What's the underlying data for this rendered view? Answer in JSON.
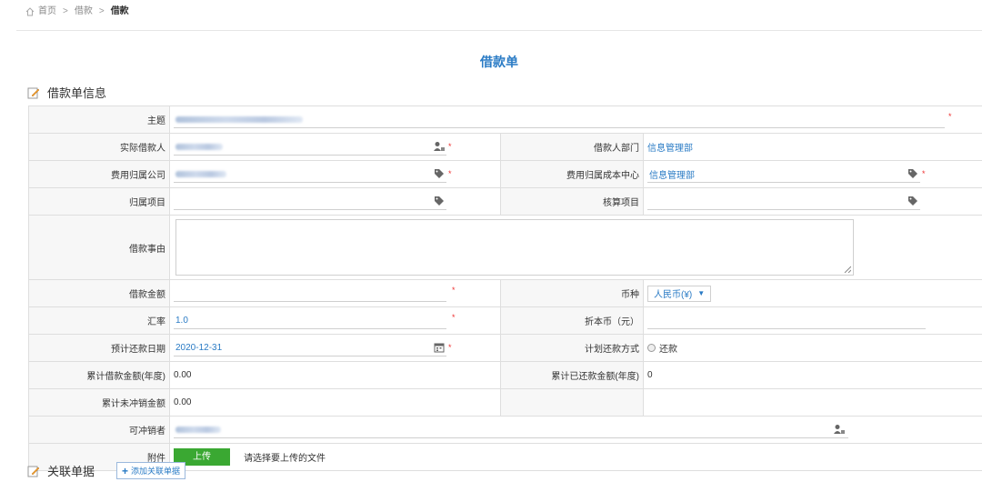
{
  "breadcrumb": {
    "home": "首页",
    "level1": "借款",
    "current": "借款"
  },
  "form": {
    "title": "借款单"
  },
  "section1": {
    "title": "借款单信息"
  },
  "fields": {
    "subject": {
      "label": "主题"
    },
    "borrower": {
      "label": "实际借款人"
    },
    "borrower_dept": {
      "label": "借款人部门",
      "value": "信息管理部"
    },
    "company": {
      "label": "费用归属公司"
    },
    "cost_center": {
      "label": "费用归属成本中心",
      "value": "信息管理部"
    },
    "project": {
      "label": "归属项目"
    },
    "account_item": {
      "label": "核算项目"
    },
    "reason": {
      "label": "借款事由"
    },
    "amount": {
      "label": "借款金额"
    },
    "currency": {
      "label": "币种",
      "value": "人民币(¥)"
    },
    "rate": {
      "label": "汇率",
      "value": "1.0"
    },
    "local_amount": {
      "label": "折本币（元）"
    },
    "repay_date": {
      "label": "预计还款日期",
      "value": "2020-12-31"
    },
    "repay_method": {
      "label": "计划还款方式",
      "option": "还款"
    },
    "total_borrowed": {
      "label": "累计借款金额(年度)",
      "value": "0.00"
    },
    "total_repaid": {
      "label": "累计已还款金额(年度)",
      "value": "0"
    },
    "unoffset": {
      "label": "累计未冲销金额",
      "value": "0.00"
    },
    "offsetter": {
      "label": "可冲销者"
    },
    "attachment": {
      "label": "附件",
      "button": "上传",
      "hint": "请选择要上传的文件"
    }
  },
  "required_mark": "*",
  "section2": {
    "title": "关联单据",
    "add_button": "添加关联单据"
  },
  "colors": {
    "accent": "#2a7bc5",
    "upload": "#3aa832",
    "required": "#e33333"
  },
  "icons": [
    "home-icon",
    "pen-icon",
    "person-picker-icon",
    "tag-icon",
    "calendar-icon",
    "resize-grip-icon",
    "dropdown-arrow-icon",
    "plus-icon"
  ]
}
